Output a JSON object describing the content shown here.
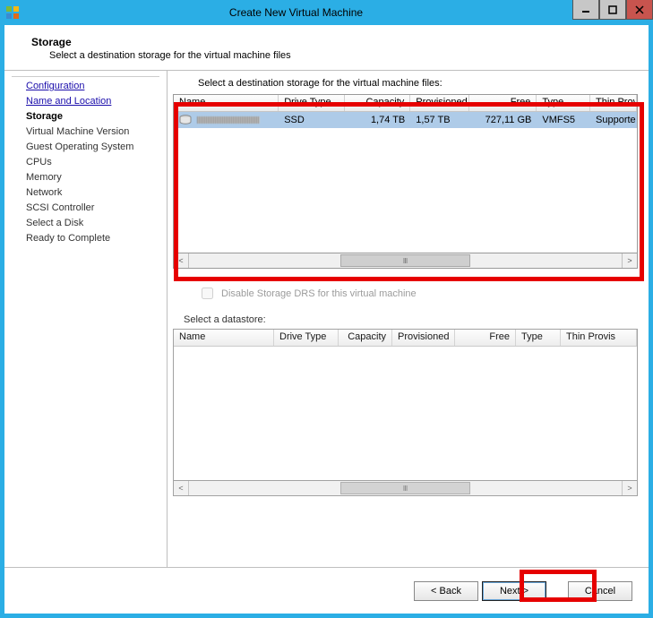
{
  "window": {
    "title": "Create New Virtual Machine"
  },
  "header": {
    "heading": "Storage",
    "sub": "Select a destination storage for the virtual machine files"
  },
  "sidebar": {
    "items": [
      {
        "label": "Configuration",
        "kind": "link"
      },
      {
        "label": "Name and Location",
        "kind": "link"
      },
      {
        "label": "Storage",
        "kind": "current"
      },
      {
        "label": "Virtual Machine Version",
        "kind": "future"
      },
      {
        "label": "Guest Operating System",
        "kind": "future"
      },
      {
        "label": "CPUs",
        "kind": "future"
      },
      {
        "label": "Memory",
        "kind": "future"
      },
      {
        "label": "Network",
        "kind": "future"
      },
      {
        "label": "SCSI Controller",
        "kind": "future"
      },
      {
        "label": "Select a Disk",
        "kind": "future"
      },
      {
        "label": "Ready to Complete",
        "kind": "future"
      }
    ]
  },
  "main": {
    "instruction": "Select a destination storage for the virtual machine files:",
    "storage_table": {
      "columns": {
        "name": "Name",
        "drive": "Drive Type",
        "capacity": "Capacity",
        "provisioned": "Provisioned",
        "free": "Free",
        "type": "Type",
        "thin": "Thin Prov"
      },
      "row": {
        "drive": "SSD",
        "capacity": "1,74 TB",
        "provisioned": "1,57 TB",
        "free": "727,11 GB",
        "type": "VMFS5",
        "thin": "Supporte"
      }
    },
    "disable_drs_label": "Disable Storage DRS for this virtual machine",
    "select_datastore_label": "Select a datastore:",
    "datastore_table": {
      "columns": {
        "name": "Name",
        "drive": "Drive Type",
        "capacity": "Capacity",
        "provisioned": "Provisioned",
        "free": "Free",
        "type": "Type",
        "thin": "Thin Provis"
      }
    }
  },
  "footer": {
    "back": "< Back",
    "next": "Next >",
    "cancel": "Cancel"
  }
}
